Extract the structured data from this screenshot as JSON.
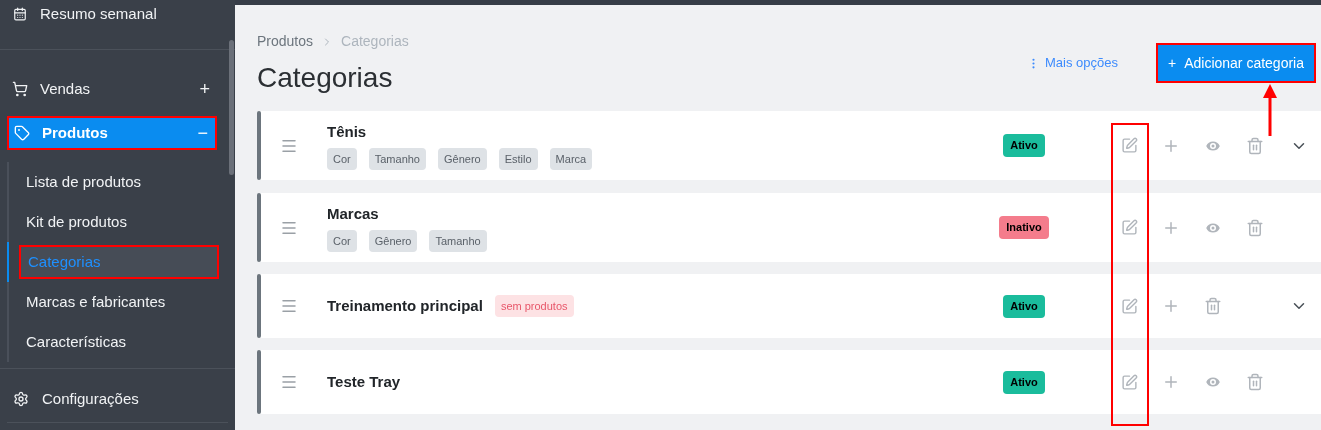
{
  "sidebar": {
    "top_item": {
      "label": "Resumo semanal"
    },
    "items": [
      {
        "kind": "cart",
        "label": "Vendas",
        "toggle": "+",
        "selected": false,
        "highlighted": false
      },
      {
        "kind": "tag",
        "label": "Produtos",
        "toggle": "−",
        "selected": true,
        "highlighted": true
      }
    ],
    "sub_items": [
      {
        "label": "Lista de produtos",
        "selected": false,
        "highlighted": false
      },
      {
        "label": "Kit de produtos",
        "selected": false,
        "highlighted": false
      },
      {
        "label": "Categorias",
        "selected": true,
        "highlighted": true
      },
      {
        "label": "Marcas e fabricantes",
        "selected": false,
        "highlighted": false
      },
      {
        "label": "Características",
        "selected": false,
        "highlighted": false
      }
    ],
    "footer_item": {
      "label": "Configurações"
    }
  },
  "breadcrumb": [
    "Produtos",
    "Categorias"
  ],
  "title": "Categorias",
  "more_options": "Mais opções",
  "add_button": {
    "icon": "+",
    "label": "Adicionar categoria",
    "highlighted": true
  },
  "categories": [
    {
      "name": "Tênis",
      "tags": [
        "Cor",
        "Tamanho",
        "Gênero",
        "Estilo",
        "Marca"
      ],
      "status": {
        "kind": "active",
        "label": "Ativo"
      },
      "viewable": true,
      "expandable": true
    },
    {
      "name": "Marcas",
      "tags": [
        "Cor",
        "Gênero",
        "Tamanho"
      ],
      "status": {
        "kind": "inactive",
        "label": "Inativo"
      },
      "viewable": true,
      "expandable": false
    },
    {
      "name": "Treinamento principal",
      "empty_label": "sem produtos",
      "status": {
        "kind": "active",
        "label": "Ativo"
      },
      "viewable": false,
      "expandable": true
    },
    {
      "name": "Teste Tray",
      "status": {
        "kind": "active",
        "label": "Ativo"
      },
      "viewable": true,
      "expandable": false
    }
  ]
}
